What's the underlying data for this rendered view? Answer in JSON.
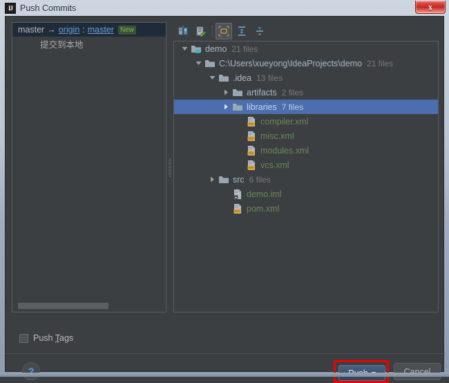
{
  "window": {
    "title": "Push Commits",
    "app_icon": "IJ",
    "close_icon": "x"
  },
  "left_panel": {
    "branch": {
      "source": "master",
      "arrow": "→",
      "remote": "origin",
      "separator": ":",
      "target": "master",
      "badge": "New"
    },
    "commit_message": "提交到本地"
  },
  "toolbar": {
    "buttons": [
      {
        "name": "show-diff-icon",
        "title": "Show Diff"
      },
      {
        "name": "edit-source-icon",
        "title": "Edit Source"
      },
      {
        "name": "group-by-directory-icon",
        "title": "Group By Directory",
        "selected": true
      },
      {
        "name": "expand-all-icon",
        "title": "Expand All"
      },
      {
        "name": "collapse-all-icon",
        "title": "Collapse All"
      }
    ]
  },
  "tree": {
    "rows": [
      {
        "indent": 0,
        "twisty": "down",
        "icon": "module-folder-icon",
        "label": "demo",
        "count": "21 files",
        "kind": "dir",
        "selected": false
      },
      {
        "indent": 1,
        "twisty": "down",
        "icon": "folder-icon",
        "label": "C:\\Users\\xueyong\\IdeaProjects\\demo",
        "count": "21 files",
        "kind": "dir",
        "selected": false
      },
      {
        "indent": 2,
        "twisty": "down",
        "icon": "folder-icon",
        "label": ".idea",
        "count": "13 files",
        "kind": "dir",
        "selected": false
      },
      {
        "indent": 3,
        "twisty": "right",
        "icon": "folder-icon",
        "label": "artifacts",
        "count": "2 files",
        "kind": "dir",
        "selected": false
      },
      {
        "indent": 3,
        "twisty": "right",
        "icon": "folder-icon",
        "label": "libraries",
        "count": "7 files",
        "kind": "dir",
        "selected": true
      },
      {
        "indent": 4,
        "twisty": "none",
        "icon": "xml-file-icon",
        "label": "compiler.xml",
        "count": "",
        "kind": "file",
        "selected": false
      },
      {
        "indent": 4,
        "twisty": "none",
        "icon": "xml-file-icon",
        "label": "misc.xml",
        "count": "",
        "kind": "file",
        "selected": false
      },
      {
        "indent": 4,
        "twisty": "none",
        "icon": "xml-file-icon",
        "label": "modules.xml",
        "count": "",
        "kind": "file",
        "selected": false
      },
      {
        "indent": 4,
        "twisty": "none",
        "icon": "xml-file-icon",
        "label": "vcs.xml",
        "count": "",
        "kind": "file",
        "selected": false
      },
      {
        "indent": 2,
        "twisty": "right",
        "icon": "folder-icon",
        "label": "src",
        "count": "6 files",
        "kind": "dir",
        "selected": false
      },
      {
        "indent": 3,
        "twisty": "none",
        "icon": "iml-file-icon",
        "label": "demo.iml",
        "count": "",
        "kind": "file",
        "selected": false
      },
      {
        "indent": 3,
        "twisty": "none",
        "icon": "xml-file-icon",
        "label": "pom.xml",
        "count": "",
        "kind": "file",
        "selected": false
      }
    ]
  },
  "footer": {
    "push_tags_label_pre": "Push ",
    "push_tags_mnemonic": "T",
    "push_tags_label_post": "ags",
    "push_tags_checked": false,
    "help_label": "?",
    "push_label": "Push",
    "cancel_label": "Cancel"
  },
  "colors": {
    "selection_blue": "#4b6eaf",
    "file_green": "#6a8759",
    "dir_text": "#a9b7c6",
    "link_blue": "#6aa0d8",
    "badge_green": "#78b35c",
    "highlight_red": "#ee0000",
    "panel_bg": "#3c3f41"
  }
}
